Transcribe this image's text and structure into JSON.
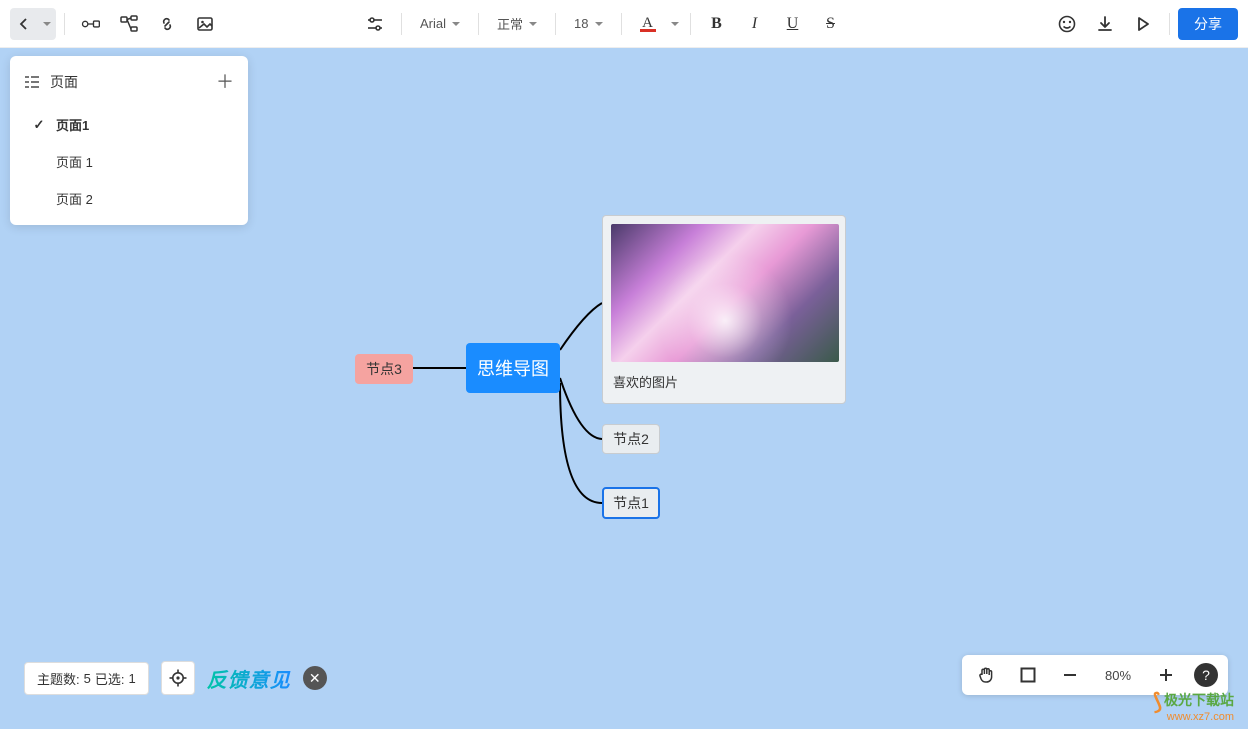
{
  "toolbar": {
    "font_family": "Arial",
    "text_style": "正常",
    "font_size": "18",
    "share_label": "分享"
  },
  "pages_panel": {
    "title": "页面",
    "items": [
      {
        "label": "页面1",
        "active": true
      },
      {
        "label": "页面 1",
        "active": false
      },
      {
        "label": "页面 2",
        "active": false
      }
    ]
  },
  "mindmap": {
    "central": "思维导图",
    "node3": "节点3",
    "node2": "节点2",
    "node1": "节点1",
    "image_caption": "喜欢的图片"
  },
  "status": {
    "topics_label": "主题数:",
    "topics_count": "5",
    "selected_label": "已选:",
    "selected_count": "1",
    "feedback_label": "反馈意见"
  },
  "zoom": {
    "level": "80%"
  },
  "watermark": {
    "line1": "极光下载站",
    "line2": "www.xz7.com"
  }
}
